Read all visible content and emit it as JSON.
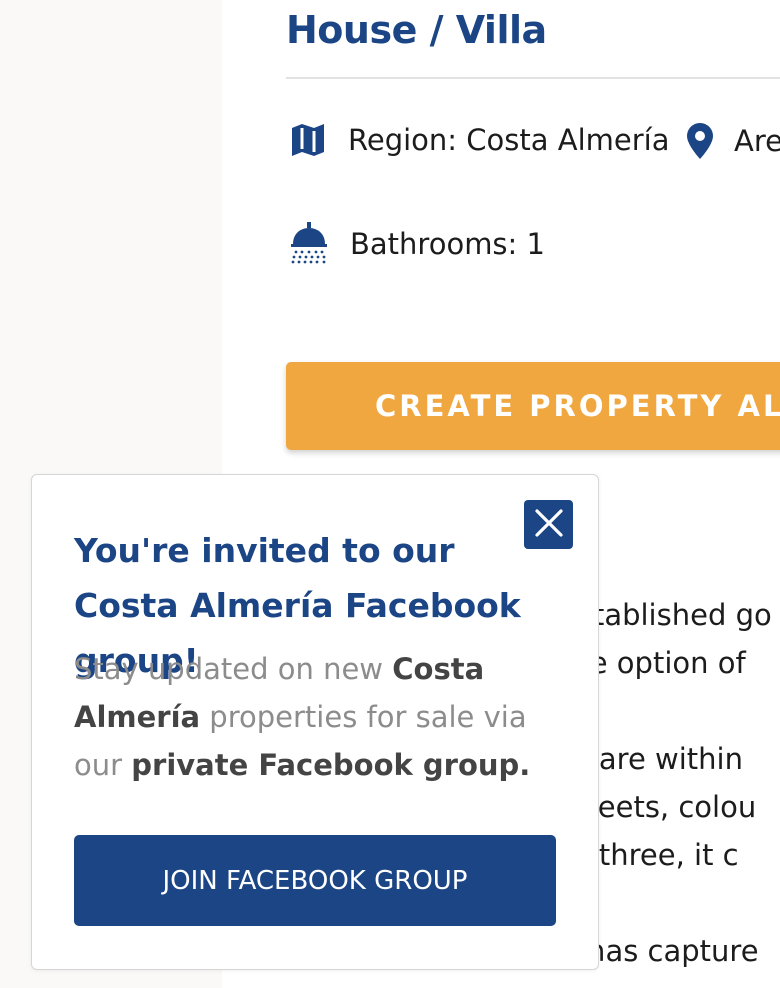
{
  "property": {
    "title": "House / Villa",
    "region": "Region: Costa Almería",
    "area": "Are",
    "bathrooms": "Bathrooms: 1"
  },
  "alert": {
    "label": "CREATE PROPERTY ALE"
  },
  "description_fragments": [
    "established go",
    "the option of",
    "ar are within",
    "streets, colou",
    " or three, it c",
    "e has capture"
  ],
  "popup": {
    "heading": "You're invited to our Costa Almería Facebook group!",
    "body_1": "Stay updated on new ",
    "body_bold_1": "Costa Almería",
    "body_2": " properties for sale via our ",
    "body_bold_2": "private Facebook group.",
    "join_label": "JOIN FACEBOOK GROUP"
  },
  "colors": {
    "brand_blue": "#1b4585",
    "accent_orange": "#f0a740"
  },
  "icons": {
    "region": "map-icon",
    "area": "location-pin-icon",
    "bathrooms": "shower-icon",
    "close": "close-icon"
  }
}
